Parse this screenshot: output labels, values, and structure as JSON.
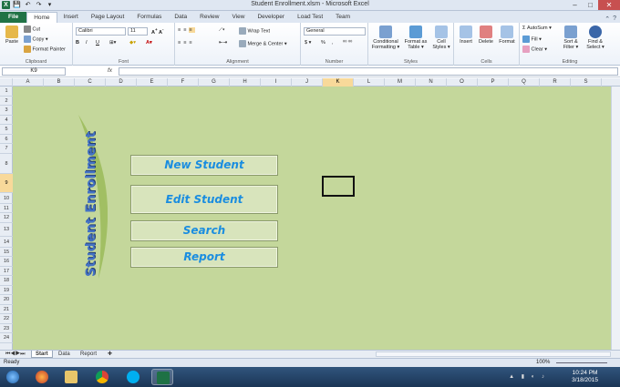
{
  "window": {
    "title": "Student Enrollment.xlsm - Microsoft Excel",
    "controls": [
      "–",
      "□",
      "✕"
    ]
  },
  "quick_access": [
    "X",
    "💾",
    "↶",
    "↷",
    "▾"
  ],
  "tabs": [
    "File",
    "Home",
    "Insert",
    "Page Layout",
    "Formulas",
    "Data",
    "Review",
    "View",
    "Developer",
    "Load Test",
    "Team"
  ],
  "active_tab": "Home",
  "ribbon": {
    "clipboard": {
      "label": "Clipboard",
      "paste": "Paste",
      "cut": "Cut",
      "copy": "Copy ▾",
      "format_painter": "Format Painter"
    },
    "font": {
      "label": "Font",
      "family": "Calibri",
      "size": "11",
      "bold": "B",
      "italic": "I",
      "underline": "U"
    },
    "alignment": {
      "label": "Alignment",
      "wrap": "Wrap Text",
      "merge": "Merge & Center ▾"
    },
    "number": {
      "label": "Number",
      "format": "General",
      "currency": "$ ▾",
      "percent": "%",
      "comma": ","
    },
    "styles": {
      "label": "Styles",
      "conditional": "Conditional Formatting ▾",
      "format_table": "Format as Table ▾",
      "cell_styles": "Cell Styles ▾"
    },
    "cells": {
      "label": "Cells",
      "insert": "Insert",
      "delete": "Delete",
      "format": "Format"
    },
    "editing": {
      "label": "Editing",
      "autosum": "AutoSum ▾",
      "fill": "Fill ▾",
      "clear": "Clear ▾",
      "sort": "Sort & Filter ▾",
      "find": "Find & Select ▾"
    }
  },
  "formula_bar": {
    "name_box": "K9",
    "fx": "fx",
    "value": ""
  },
  "columns": [
    "A",
    "B",
    "C",
    "D",
    "E",
    "F",
    "G",
    "H",
    "I",
    "J",
    "K",
    "L",
    "M",
    "N",
    "O",
    "P",
    "Q",
    "R",
    "S"
  ],
  "selected_column": "K",
  "rows": [
    "1",
    "2",
    "3",
    "4",
    "5",
    "6",
    "7",
    "8",
    "9",
    "10",
    "11",
    "12",
    "13",
    "14",
    "15",
    "16",
    "17",
    "18",
    "19",
    "20",
    "21",
    "22",
    "23",
    "24"
  ],
  "selected_row": "9",
  "dashboard": {
    "brand": "Student Enrollment",
    "buttons": [
      "New Student",
      "Edit Student",
      "Search",
      "Report"
    ]
  },
  "sheets": [
    "Start",
    "Data",
    "Report"
  ],
  "active_sheet": "Start",
  "status": {
    "ready": "Ready",
    "zoom": "100%"
  },
  "taskbar": {
    "time": "10:24 PM",
    "date": "3/18/2015"
  }
}
